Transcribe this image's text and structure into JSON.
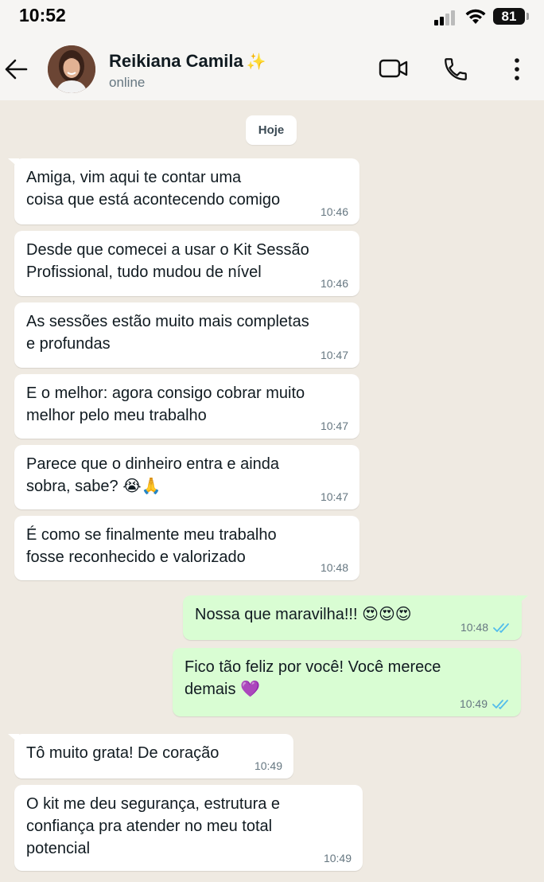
{
  "status_bar": {
    "time": "10:52",
    "battery": "81"
  },
  "header": {
    "name": "Reikiana Camila",
    "status": "online"
  },
  "date_chip": "Hoje",
  "messages": [
    {
      "dir": "in",
      "text": "Amiga, vim aqui te contar uma\ncoisa que está acontecendo comigo",
      "time": "10:46"
    },
    {
      "dir": "in",
      "text": "Desde que comecei a usar o Kit Sessão\nProfissional, tudo mudou de nível",
      "time": "10:46"
    },
    {
      "dir": "in",
      "text": "As sessões estão muito mais completas\ne profundas",
      "time": "10:47"
    },
    {
      "dir": "in",
      "text": "E o melhor: agora consigo cobrar muito\nmelhor pelo meu trabalho",
      "time": "10:47"
    },
    {
      "dir": "in",
      "text": "Parece que o dinheiro entra e ainda\nsobra, sabe? 😭🙏",
      "time": "10:47"
    },
    {
      "dir": "in",
      "text": "É como se finalmente meu trabalho\nfosse reconhecido e valorizado",
      "time": "10:48"
    },
    {
      "dir": "out",
      "text": "Nossa que maravilha!!! 😍😍😍",
      "time": "10:48"
    },
    {
      "dir": "out",
      "text": "Fico tão feliz por você! Você merece\ndemais 💜",
      "time": "10:49"
    },
    {
      "dir": "in",
      "text": "Tô muito grata! De coração",
      "time": "10:49"
    },
    {
      "dir": "in",
      "text": "O kit me deu segurança, estrutura e\nconfiança pra atender no meu total\npotencial",
      "time": "10:49"
    }
  ],
  "colors": {
    "chat_bg": "#efeae2",
    "incoming": "#ffffff",
    "outgoing": "#d9fdd3",
    "read_tick": "#53bdeb"
  }
}
